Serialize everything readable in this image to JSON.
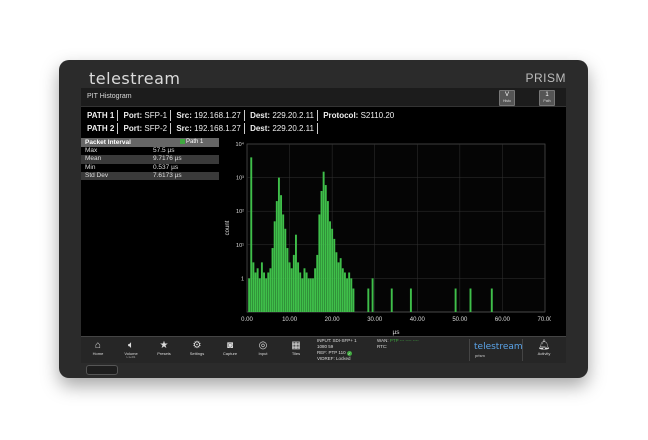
{
  "device": {
    "brand": "telestream",
    "model": "PRISM"
  },
  "app": {
    "title": "PIT Histogram",
    "btn_hist": "V",
    "btn_hist_sub": "Histo",
    "btn_path": "1",
    "btn_path_sub": "Path"
  },
  "paths": [
    {
      "label": "PATH 1",
      "port_label": "Port:",
      "port": "SFP-1",
      "src_label": "Src:",
      "src": "192.168.1.27",
      "dest_label": "Dest:",
      "dest": "229.20.2.11",
      "protocol_label": "Protocol:",
      "protocol": "S2110.20"
    },
    {
      "label": "PATH 2",
      "port_label": "Port:",
      "port": "SFP-2",
      "src_label": "Src:",
      "src": "192.168.1.27",
      "dest_label": "Dest:",
      "dest": "229.20.2.11"
    }
  ],
  "stats": {
    "header": "Packet Interval",
    "path_tag": "Path 1",
    "rows": [
      {
        "label": "Max",
        "value": "57.5 µs"
      },
      {
        "label": "Mean",
        "value": "9.7176 µs"
      },
      {
        "label": "Min",
        "value": "0.537 µs"
      },
      {
        "label": "Std Dev",
        "value": "7.6173 µs"
      }
    ]
  },
  "chart_data": {
    "type": "bar",
    "xlabel": "µs",
    "ylabel": "count",
    "xlim": [
      0,
      70
    ],
    "y_scale": "log",
    "ylim": [
      0.1,
      10000
    ],
    "x_ticks": [
      "0.00",
      "10.00",
      "20.00",
      "30.00",
      "40.00",
      "50.00",
      "60.00",
      "70.00"
    ],
    "y_ticks": [
      "1",
      "10¹",
      "10²",
      "10³",
      "10⁴"
    ],
    "grid": true,
    "series_color": "#3fbf4a",
    "x": [
      0.5,
      1.0,
      1.5,
      2.0,
      2.5,
      3.0,
      3.5,
      4.0,
      4.5,
      5.0,
      5.5,
      6.0,
      6.5,
      7.0,
      7.5,
      8.0,
      8.5,
      9.0,
      9.5,
      10.0,
      10.5,
      11.0,
      11.5,
      12.0,
      12.5,
      13.0,
      13.5,
      14.0,
      14.5,
      15.0,
      15.5,
      16.0,
      16.5,
      17.0,
      17.5,
      18.0,
      18.5,
      19.0,
      19.5,
      20.0,
      20.5,
      21.0,
      21.5,
      22.0,
      22.5,
      23.0,
      23.5,
      24.0,
      24.5,
      25.0,
      28.5,
      29.5,
      34.0,
      38.5,
      49.0,
      52.5,
      57.5
    ],
    "values": [
      1,
      4000,
      3,
      1.5,
      2,
      1,
      3,
      1.5,
      1,
      1.5,
      2,
      8,
      50,
      200,
      1000,
      300,
      80,
      30,
      8,
      3,
      2,
      5,
      20,
      3,
      1.5,
      1,
      2,
      1.5,
      1,
      1,
      1,
      2,
      5,
      80,
      400,
      1500,
      600,
      200,
      50,
      30,
      15,
      6,
      3,
      4,
      2,
      1.5,
      1,
      1.5,
      1,
      0.5,
      0.5,
      1,
      0.5,
      0.5,
      0.5,
      0.5,
      0.5
    ]
  },
  "dock": {
    "items": [
      {
        "label": "Home",
        "icon": "home-icon"
      },
      {
        "label": "Volume",
        "sub": "L1+R1",
        "icon": "volume-icon"
      },
      {
        "label": "Presets",
        "icon": "star-icon"
      },
      {
        "label": "Settings",
        "icon": "gear-icon"
      },
      {
        "label": "Capture",
        "icon": "camera-icon"
      },
      {
        "label": "Input",
        "icon": "input-icon"
      },
      {
        "label": "Tiles",
        "icon": "tiles-icon"
      }
    ],
    "status": {
      "input": "INPUT: SDI-SFP+ 1",
      "format": "1080 59",
      "ref": "REF: PTP 110",
      "vidref": "VIDREF: Locked"
    },
    "status2": {
      "wan": "WAN:",
      "wan_val": "PTP --- ---- ----",
      "rtc": "RTC:"
    },
    "logo": "telestream",
    "logo_sub": "prism",
    "activity": "Activity"
  }
}
